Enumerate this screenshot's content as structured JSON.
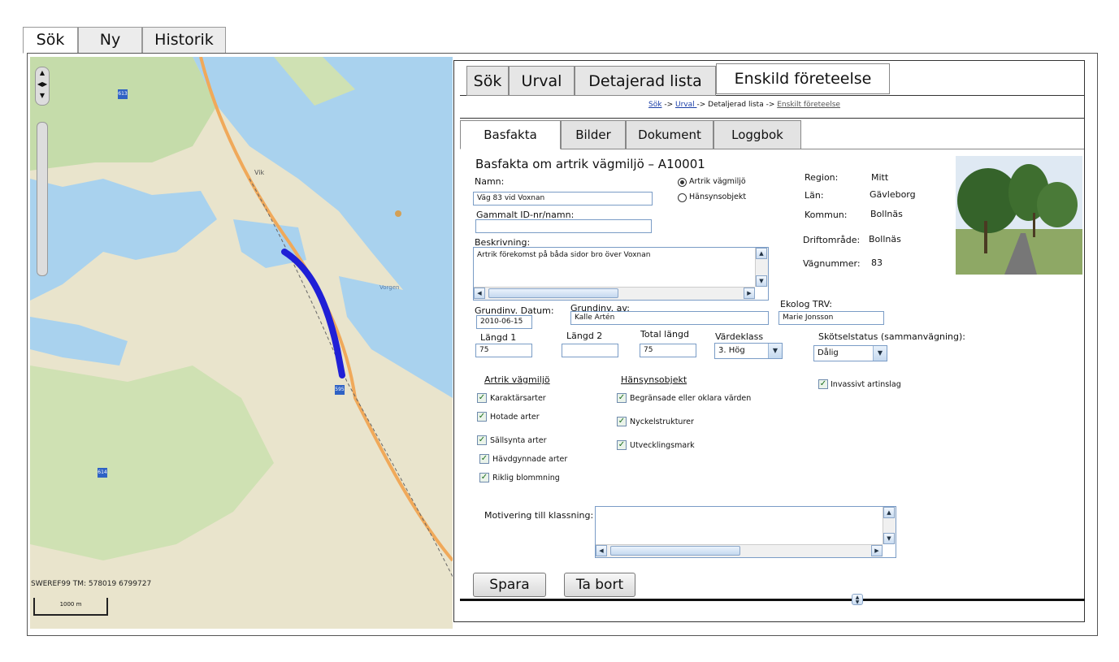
{
  "outer_tabs": [
    "Sök",
    "Ny",
    "Historik"
  ],
  "map": {
    "coords": "SWEREF99 TM: 578019 6799727",
    "scale": "1000 m",
    "road_shields": [
      "613",
      "595",
      "614"
    ],
    "place_labels": [
      "Vik",
      "Vorgen"
    ],
    "route_color": "#1f1fd6"
  },
  "inner_tabs": [
    "Sök",
    "Urval",
    "Detajerad lista",
    "Enskild företeelse"
  ],
  "breadcrumb": {
    "sok": "Sök",
    "sep1": " -> ",
    "urval": "Urval ",
    "sep2": "-> Detaljerad lista ->",
    "current": "Enskilt företeelse"
  },
  "sub_tabs": [
    "Basfakta",
    "Bilder",
    "Dokument",
    "Loggbok"
  ],
  "form": {
    "heading": "Basfakta om artrik vägmiljö – A10001",
    "namn_label": "Namn:",
    "namn_value": "Väg 83 vid Voxnan",
    "radio_artrik": "Artrik vägmiljö",
    "radio_hansyn": "Hänsynsobjekt",
    "gammalt_label": "Gammalt ID-nr/namn:",
    "gammalt_value": "",
    "beskrivning_label": "Beskrivning:",
    "beskrivning_value": "Artrik förekomst på båda sidor bro över Voxnan",
    "region_label": "Region:",
    "region_value": "Mitt",
    "lan_label": "Län:",
    "lan_value": "Gävleborg",
    "kommun_label": "Kommun:",
    "kommun_value": "Bollnäs",
    "drift_label": "Driftområde:",
    "drift_value": "Bollnäs",
    "vag_label": "Vägnummer:",
    "vag_value": "83",
    "grundinv_datum_label": "Grundinv. Datum:",
    "grundinv_datum_value": "2010-06-15",
    "grundinv_av_label": "Grundinv. av:",
    "grundinv_av_value": "Kalle Artén",
    "ekolog_label": "Ekolog TRV:",
    "ekolog_value": "Marie Jonsson",
    "langd1_label": "Längd 1",
    "langd1_value": "75",
    "langd2_label": "Längd 2",
    "langd2_value": "",
    "total_label": "Total längd",
    "total_value": "75",
    "vardeklass_label": "Värdeklass",
    "vardeklass_value": "3. Hög",
    "skotsel_label": "Skötselstatus (sammanvägning):",
    "skotsel_value": "Dålig",
    "artrik_heading": "Artrik vägmiljö",
    "hansyn_heading": "Hänsynsobjekt",
    "artrik_items": [
      "Karaktärsarter",
      "Hotade arter",
      "Sällsynta arter",
      "Hävdgynnade arter",
      "Riklig blommning"
    ],
    "hansyn_items": [
      "Begränsade eller oklara värden",
      "Nyckelstrukturer",
      "Utvecklingsmark"
    ],
    "invasivt": "Invassivt artinslag",
    "motivering_label": "Motivering till klassning:",
    "motivering_value": ""
  },
  "buttons": {
    "save": "Spara",
    "delete": "Ta bort"
  }
}
